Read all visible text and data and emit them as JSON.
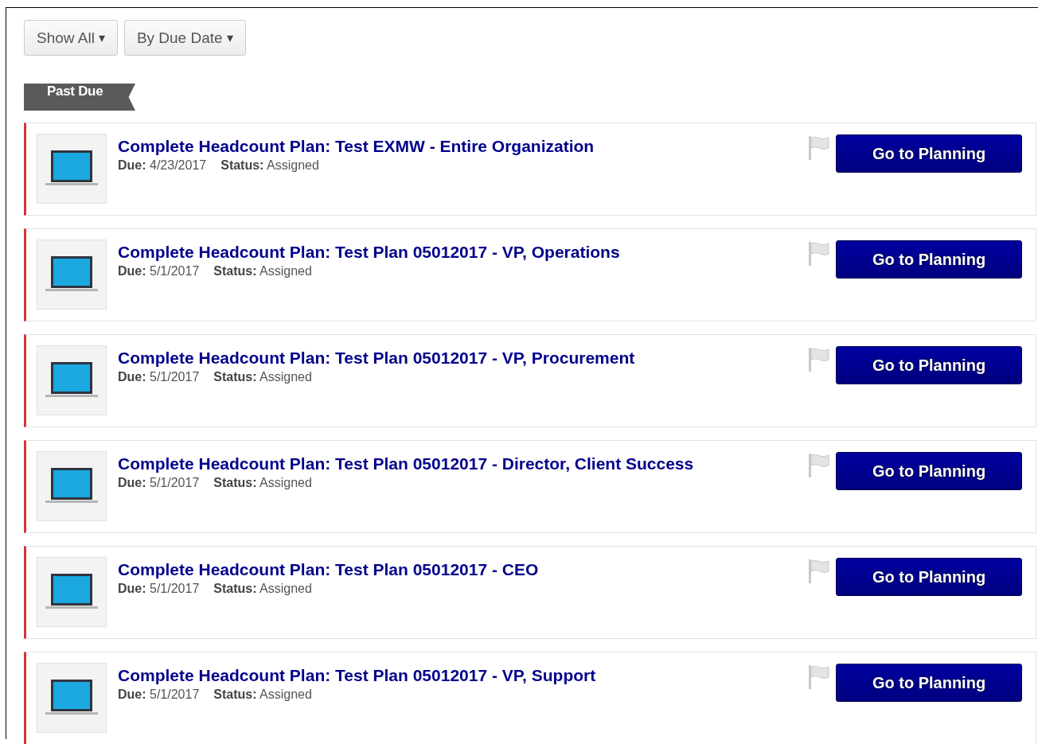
{
  "filters": [
    {
      "label": "Show All",
      "caret": "▾"
    },
    {
      "label": "By Due Date",
      "caret": "▾"
    }
  ],
  "section": {
    "title": "Past Due"
  },
  "tasks": [
    {
      "title": "Complete Headcount Plan: Test EXMW - Entire Organization",
      "due_label": "Due:",
      "due": "4/23/2017",
      "status_label": "Status:",
      "status": "Assigned",
      "action": "Go to Planning"
    },
    {
      "title": "Complete Headcount Plan: Test Plan 05012017 - VP, Operations",
      "due_label": "Due:",
      "due": "5/1/2017",
      "status_label": "Status:",
      "status": "Assigned",
      "action": "Go to Planning"
    },
    {
      "title": "Complete Headcount Plan: Test Plan 05012017 - VP, Procurement",
      "due_label": "Due:",
      "due": "5/1/2017",
      "status_label": "Status:",
      "status": "Assigned",
      "action": "Go to Planning"
    },
    {
      "title": "Complete Headcount Plan: Test Plan 05012017 - Director, Client Success",
      "due_label": "Due:",
      "due": "5/1/2017",
      "status_label": "Status:",
      "status": "Assigned",
      "action": "Go to Planning"
    },
    {
      "title": "Complete Headcount Plan: Test Plan 05012017 - CEO",
      "due_label": "Due:",
      "due": "5/1/2017",
      "status_label": "Status:",
      "status": "Assigned",
      "action": "Go to Planning"
    },
    {
      "title": "Complete Headcount Plan: Test Plan 05012017 - VP, Support",
      "due_label": "Due:",
      "due": "5/1/2017",
      "status_label": "Status:",
      "status": "Assigned",
      "action": "Go to Planning"
    }
  ]
}
